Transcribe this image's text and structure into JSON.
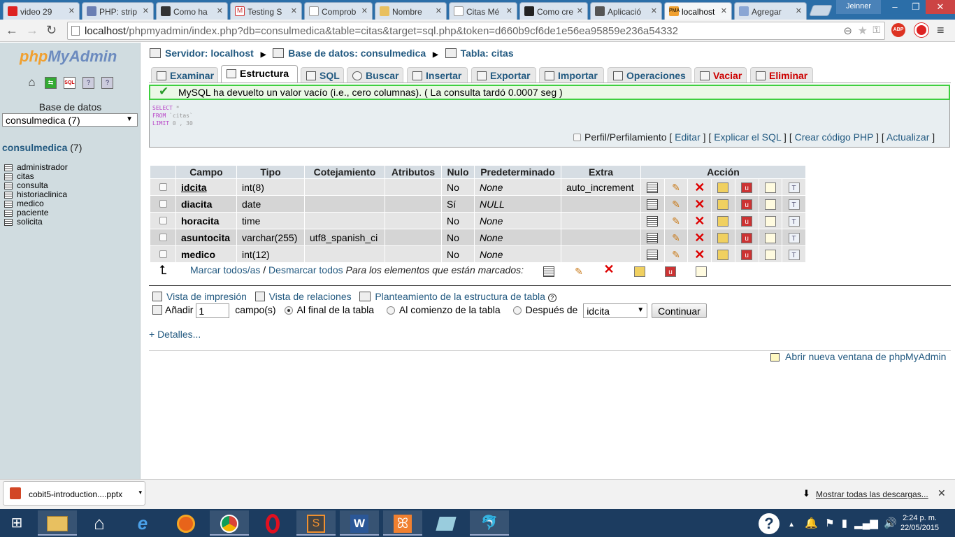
{
  "browser": {
    "tabs": [
      {
        "title": "video 29",
        "color": "#d22"
      },
      {
        "title": "PHP: strip",
        "color": "#6b7fb3"
      },
      {
        "title": "Como ha",
        "color": "#333"
      },
      {
        "title": "Testing S",
        "color": "#c33"
      },
      {
        "title": "Comprob",
        "color": "#fff"
      },
      {
        "title": "Nombre",
        "color": "#e8c060"
      },
      {
        "title": "Citas Mé",
        "color": "#fff"
      },
      {
        "title": "Como cre",
        "color": "#222"
      },
      {
        "title": "Aplicació",
        "color": "#555"
      },
      {
        "title": "localhost",
        "color": "#f0a030"
      },
      {
        "title": "Agregar",
        "color": "#8aa6d4"
      }
    ],
    "user": "Jeinner",
    "url_host": "localhost",
    "url_rest": "/phpmyadmin/index.php?db=consulmedica&table=citas&target=sql.php&token=d660b9cf6de1e56ea95859e236a54332",
    "abp_label": "ABP"
  },
  "sidebar": {
    "logo_php": "php",
    "logo_myadmin": "MyAdmin",
    "db_label": "Base de datos",
    "db_select": "consulmedica (7)",
    "db_title": "consulmedica",
    "db_count": "(7)",
    "tables": [
      "administrador",
      "citas",
      "consulta",
      "historiaclinica",
      "medico",
      "paciente",
      "solicita"
    ]
  },
  "breadcrumb": {
    "server": "Servidor: localhost",
    "database": "Base de datos: consulmedica",
    "table": "Tabla: citas"
  },
  "nav_tabs": [
    "Examinar",
    "Estructura",
    "SQL",
    "Buscar",
    "Insertar",
    "Exportar",
    "Importar",
    "Operaciones",
    "Vaciar",
    "Eliminar"
  ],
  "message": "MySQL ha devuelto un valor vacío (i.e., cero columnas). ( La consulta tardó 0.0007 seg )",
  "sql": {
    "line1_kw": "SELECT",
    "line1_rest": " *",
    "line2_kw": "FROM",
    "line2_rest": " `citas`",
    "line3_kw": "LIMIT",
    "line3_rest": " 0 , 30",
    "profiling": "Perfil/Perfilamiento",
    "edit": "Editar",
    "explain": "Explicar el SQL",
    "php_code": "Crear código PHP",
    "refresh": "Actualizar"
  },
  "structure": {
    "headers": [
      "Campo",
      "Tipo",
      "Cotejamiento",
      "Atributos",
      "Nulo",
      "Predeterminado",
      "Extra",
      "Acción"
    ],
    "rows": [
      {
        "field": "idcita",
        "type": "int(8)",
        "collation": "",
        "attributes": "",
        "null": "No",
        "default": "None",
        "extra": "auto_increment"
      },
      {
        "field": "diacita",
        "type": "date",
        "collation": "",
        "attributes": "",
        "null": "Sí",
        "default": "NULL",
        "extra": ""
      },
      {
        "field": "horacita",
        "type": "time",
        "collation": "",
        "attributes": "",
        "null": "No",
        "default": "None",
        "extra": ""
      },
      {
        "field": "asuntocita",
        "type": "varchar(255)",
        "collation": "utf8_spanish_ci",
        "attributes": "",
        "null": "No",
        "default": "None",
        "extra": ""
      },
      {
        "field": "medico",
        "type": "int(12)",
        "collation": "",
        "attributes": "",
        "null": "No",
        "default": "None",
        "extra": ""
      }
    ]
  },
  "bulk": {
    "check_all": "Marcar todos/as",
    "uncheck_all": "Desmarcar todos",
    "with_selected": "Para los elementos que están marcados:"
  },
  "links": {
    "print_view": "Vista de impresión",
    "relation_view": "Vista de relaciones",
    "propose_structure": "Planteamiento de la estructura de tabla"
  },
  "add_fields": {
    "label": "Añadir",
    "count": "1",
    "unit": "campo(s)",
    "opt_end": "Al final de la tabla",
    "opt_start": "Al comienzo de la tabla",
    "opt_after": "Después de",
    "after_column": "idcita",
    "button": "Continuar"
  },
  "details": "+ Detalles...",
  "new_window": "Abrir nueva ventana de phpMyAdmin",
  "downloads": {
    "file": "cobit5-introduction....pptx",
    "show_all": "Mostrar todas las descargas..."
  },
  "taskbar": {
    "time": "2:24 p. m.",
    "date": "22/05/2015"
  }
}
